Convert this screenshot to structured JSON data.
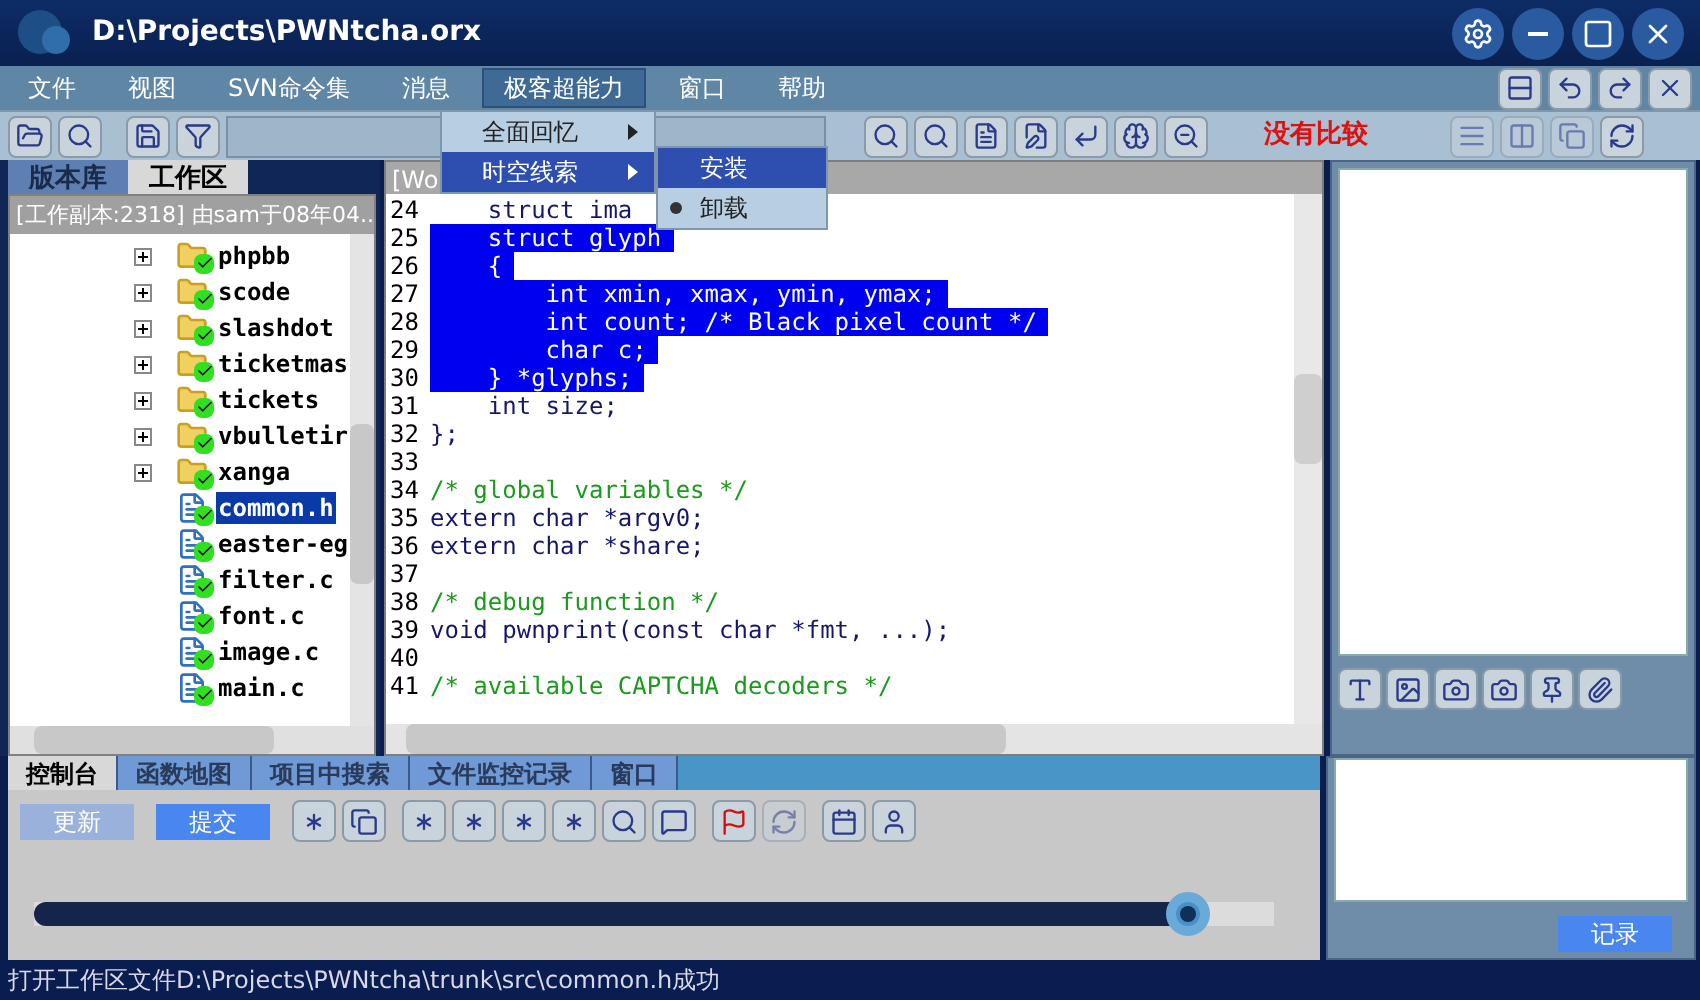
{
  "window": {
    "title": "D:\\Projects\\PWNtcha.orx"
  },
  "menu_bar": [
    {
      "label": "文件",
      "selected": false
    },
    {
      "label": "视图",
      "selected": false
    },
    {
      "label": "SVN命令集",
      "selected": false
    },
    {
      "label": "消息",
      "selected": false
    },
    {
      "label": "极客超能力",
      "selected": true
    },
    {
      "label": "窗口",
      "selected": false
    },
    {
      "label": "帮助",
      "selected": false
    }
  ],
  "open_menu": [
    {
      "label": "全面回忆",
      "selected": false
    },
    {
      "label": "时空线索",
      "selected": true
    }
  ],
  "submenu": [
    {
      "label": "安装",
      "selected": true,
      "checked": false
    },
    {
      "label": "卸载",
      "selected": false,
      "checked": true
    }
  ],
  "toolbar": {
    "compare_status": "没有比较"
  },
  "left_panel": {
    "tabs": [
      {
        "label": "版本库",
        "selected": false
      },
      {
        "label": "工作区",
        "selected": true
      }
    ],
    "info": "[工作副本:2318] 由sam于08年04...",
    "tree": [
      {
        "label": "phpbb",
        "kind": "folder",
        "selected": false
      },
      {
        "label": "scode",
        "kind": "folder",
        "selected": false
      },
      {
        "label": "slashdot",
        "kind": "folder",
        "selected": false
      },
      {
        "label": "ticketmas",
        "kind": "folder",
        "selected": false
      },
      {
        "label": "tickets",
        "kind": "folder",
        "selected": false
      },
      {
        "label": "vbulletir",
        "kind": "folder",
        "selected": false
      },
      {
        "label": "xanga",
        "kind": "folder",
        "selected": false
      },
      {
        "label": "common.h",
        "kind": "file",
        "selected": true
      },
      {
        "label": "easter-eg",
        "kind": "file",
        "selected": false
      },
      {
        "label": "filter.c",
        "kind": "file",
        "selected": false
      },
      {
        "label": "font.c",
        "kind": "file",
        "selected": false
      },
      {
        "label": "image.c",
        "kind": "file",
        "selected": false
      },
      {
        "label": "main.c",
        "kind": "file",
        "selected": false
      }
    ]
  },
  "editor": {
    "tab": "[Wo",
    "lines": [
      {
        "number": "24",
        "text": "    struct ima",
        "kind": "code",
        "selected": false
      },
      {
        "number": "25",
        "text": "    struct glyph",
        "kind": "code",
        "selected": true
      },
      {
        "number": "26",
        "text": "    {",
        "kind": "code",
        "selected": true
      },
      {
        "number": "27",
        "text": "        int xmin, xmax, ymin, ymax;",
        "kind": "code",
        "selected": true
      },
      {
        "number": "28",
        "text": "        int count; /* Black pixel count */",
        "kind": "code",
        "selected": true
      },
      {
        "number": "29",
        "text": "        char c;",
        "kind": "code",
        "selected": true
      },
      {
        "number": "30",
        "text": "    } *glyphs;",
        "kind": "code",
        "selected": true
      },
      {
        "number": "31",
        "text": "    int size;",
        "kind": "code",
        "selected": false
      },
      {
        "number": "32",
        "text": "};",
        "kind": "code",
        "selected": false
      },
      {
        "number": "33",
        "selected": false
      },
      {
        "number": "34",
        "text": "/* global variables */",
        "kind": "comment",
        "selected": false
      },
      {
        "number": "35",
        "text": "extern char *argv0;",
        "kind": "code",
        "selected": false
      },
      {
        "number": "36",
        "text": "extern char *share;",
        "kind": "code",
        "selected": false
      },
      {
        "number": "37",
        "selected": false
      },
      {
        "number": "38",
        "text": "/* debug function */",
        "kind": "comment",
        "selected": false
      },
      {
        "number": "39",
        "text": "void pwnprint(const char *fmt, ...);",
        "kind": "code",
        "selected": false
      },
      {
        "number": "40",
        "selected": false
      },
      {
        "number": "41",
        "text": "/* available CAPTCHA decoders */",
        "kind": "comment",
        "selected": false
      }
    ]
  },
  "bottom_panel": {
    "tabs": [
      {
        "label": "控制台",
        "selected": true
      },
      {
        "label": "函数地图",
        "selected": false
      },
      {
        "label": "项目中搜索",
        "selected": false
      },
      {
        "label": "文件监控记录",
        "selected": false
      },
      {
        "label": "窗口",
        "selected": false
      }
    ],
    "buttons": [
      {
        "label": "更新",
        "disabled": true
      },
      {
        "label": "提交",
        "disabled": false
      }
    ],
    "slider": {
      "level": 0.93
    }
  },
  "right_panel": {
    "button": "记录"
  },
  "status_bar": "打开工作区文件D:\\Projects\\PWNtcha\\trunk\\src\\common.h成功"
}
